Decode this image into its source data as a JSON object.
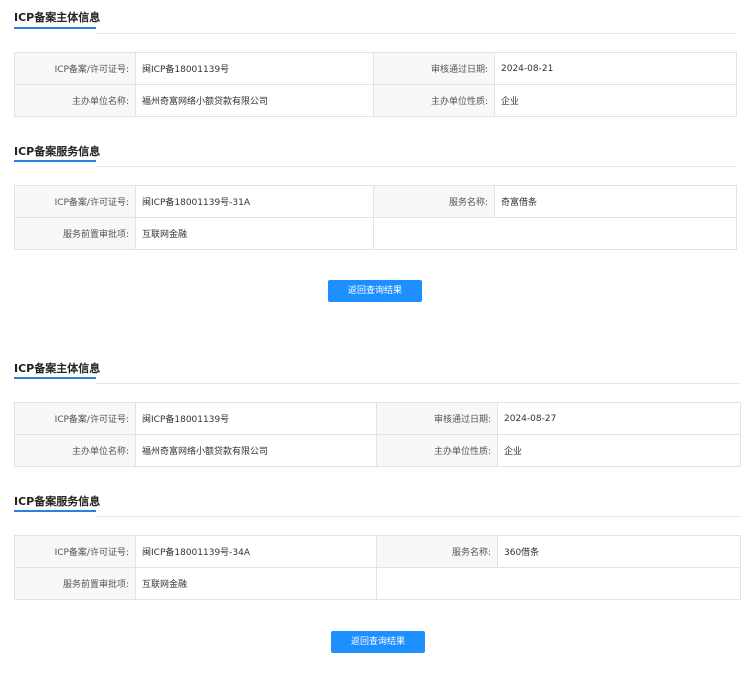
{
  "block1": {
    "entity": {
      "title": "ICP备案主体信息",
      "license_label": "ICP备案/许可证号:",
      "license_value": "闽ICP备18001139号",
      "date_label": "审核通过日期:",
      "date_value": "2024-08-21",
      "org_label": "主办单位名称:",
      "org_value": "福州奇富网络小额贷款有限公司",
      "nature_label": "主办单位性质:",
      "nature_value": "企业"
    },
    "service": {
      "title": "ICP备案服务信息",
      "license_label": "ICP备案/许可证号:",
      "license_value": "闽ICP备18001139号-31A",
      "name_label": "服务名称:",
      "name_value": "奇富借条",
      "approval_label": "服务前置审批项:",
      "approval_value": "互联网金融"
    },
    "back_button": "返回查询结果"
  },
  "block2": {
    "entity": {
      "title": "ICP备案主体信息",
      "license_label": "ICP备案/许可证号:",
      "license_value": "闽ICP备18001139号",
      "date_label": "审核通过日期:",
      "date_value": "2024-08-27",
      "org_label": "主办单位名称:",
      "org_value": "福州奇富网络小额贷款有限公司",
      "nature_label": "主办单位性质:",
      "nature_value": "企业"
    },
    "service": {
      "title": "ICP备案服务信息",
      "license_label": "ICP备案/许可证号:",
      "license_value": "闽ICP备18001139号-34A",
      "name_label": "服务名称:",
      "name_value": "360借条",
      "approval_label": "服务前置审批项:",
      "approval_value": "互联网金融"
    },
    "back_button": "返回查询结果"
  },
  "colors": {
    "accent": "#2d7fe0",
    "button": "#1e8fff",
    "label_bg": "#f7f8fa",
    "border": "#e3e3e3"
  }
}
